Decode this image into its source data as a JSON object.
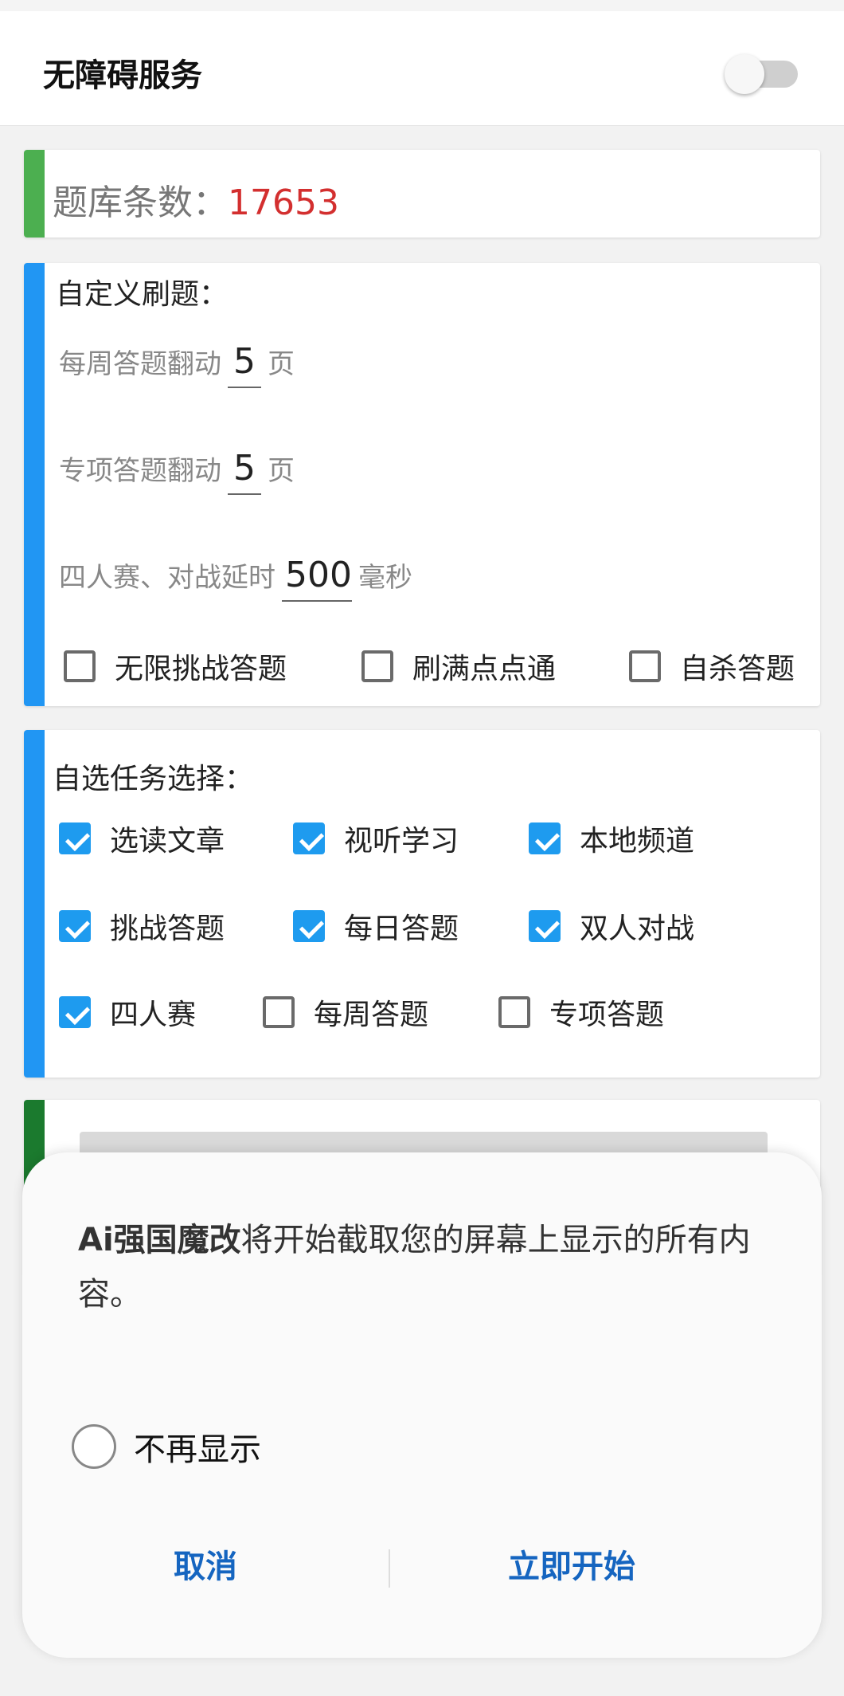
{
  "header": {
    "title": "无障碍服务",
    "switch_on": false
  },
  "question_bank": {
    "label": "题库条数：",
    "count": "17653"
  },
  "custom": {
    "title": "自定义刷题：",
    "weekly": {
      "prefix": "每周答题翻动",
      "value": "5",
      "unit": "页"
    },
    "special": {
      "prefix": "专项答题翻动",
      "value": "5",
      "unit": "页"
    },
    "delay": {
      "prefix": "四人赛、对战延时",
      "value": "500",
      "unit": "毫秒"
    },
    "options": [
      {
        "label": "无限挑战答题",
        "checked": false
      },
      {
        "label": "刷满点点通",
        "checked": false
      },
      {
        "label": "自杀答题",
        "checked": false
      }
    ]
  },
  "tasks": {
    "title": "自选任务选择：",
    "items": [
      {
        "label": "选读文章",
        "checked": true
      },
      {
        "label": "视听学习",
        "checked": true
      },
      {
        "label": "本地频道",
        "checked": true
      },
      {
        "label": "挑战答题",
        "checked": true
      },
      {
        "label": "每日答题",
        "checked": true
      },
      {
        "label": "双人对战",
        "checked": true
      },
      {
        "label": "四人赛",
        "checked": true
      },
      {
        "label": "每周答题",
        "checked": false
      },
      {
        "label": "专项答题",
        "checked": false
      }
    ]
  },
  "dialog": {
    "app_name": "Ai强国魔改",
    "message": "将开始截取您的屏幕上显示的所有内容。",
    "dont_show": "不再显示",
    "cancel": "取消",
    "start": "立即开始"
  }
}
